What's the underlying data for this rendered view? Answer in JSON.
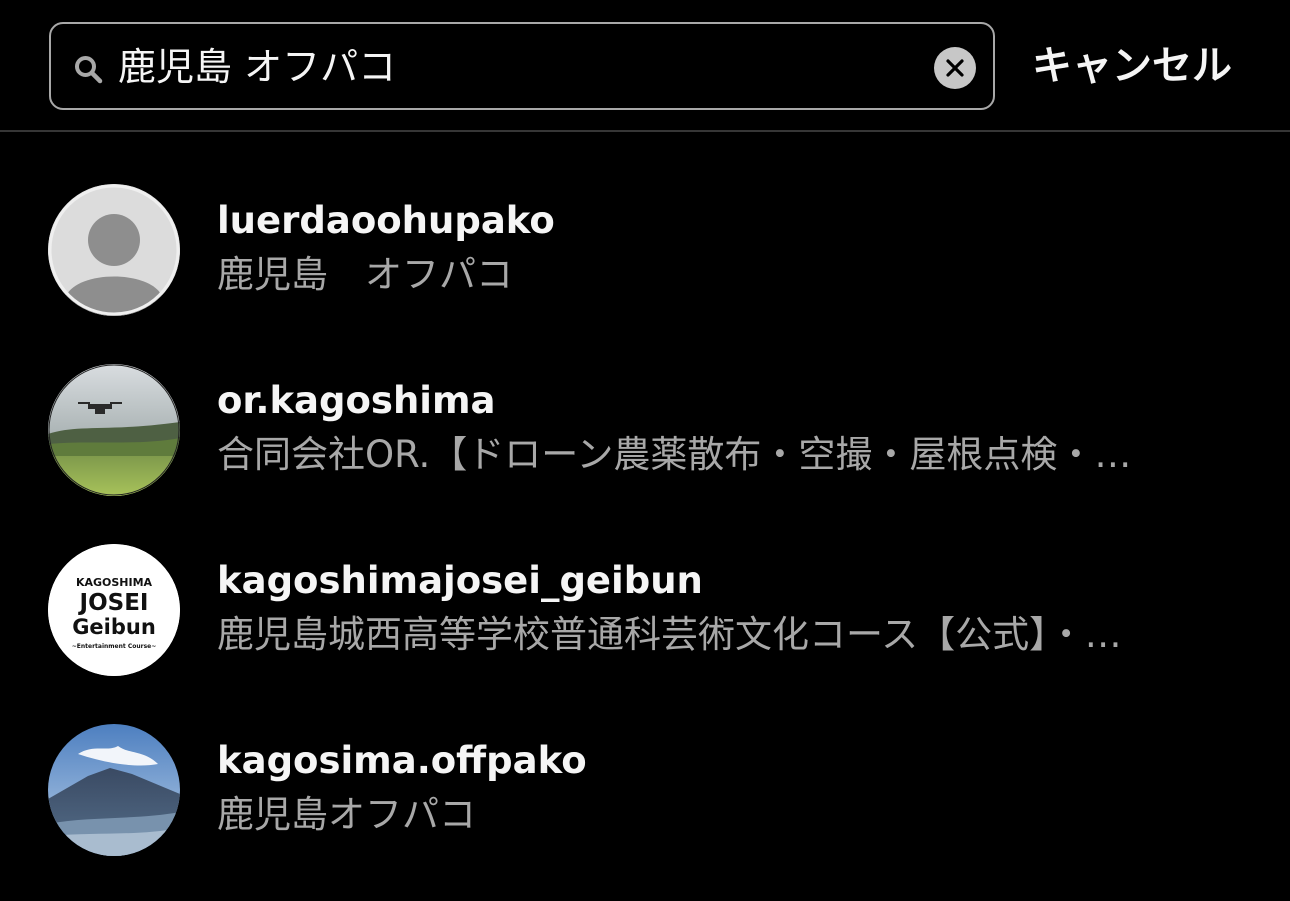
{
  "search": {
    "query": "鹿児島 オフパコ",
    "cancel_label": "キャンセル"
  },
  "results": [
    {
      "username": "luerdaoohupako",
      "fullname": "鹿児島　オフパコ",
      "avatar": "default-avatar"
    },
    {
      "username": "or.kagoshima",
      "fullname": "合同会社OR.【ドローン農薬散布・空撮・屋根点検・…",
      "avatar": "drone-field-photo"
    },
    {
      "username": "kagoshimajosei_geibun",
      "fullname": "鹿児島城西高等学校普通科芸術文化コース【公式】・…",
      "avatar": "logo",
      "logo_text": {
        "line1": "KAGOSHIMA",
        "line2": "JOSEI",
        "line3": "Geibun",
        "line4": "~Entertainment Course~"
      }
    },
    {
      "username": "kagosima.offpako",
      "fullname": "鹿児島オフパコ",
      "avatar": "volcano-photo"
    }
  ],
  "colors": {
    "background": "#000000",
    "primary_text": "#f5f5f5",
    "secondary_text": "#a8a8a8",
    "search_border": "#a8a8a8",
    "divider": "#363636"
  }
}
